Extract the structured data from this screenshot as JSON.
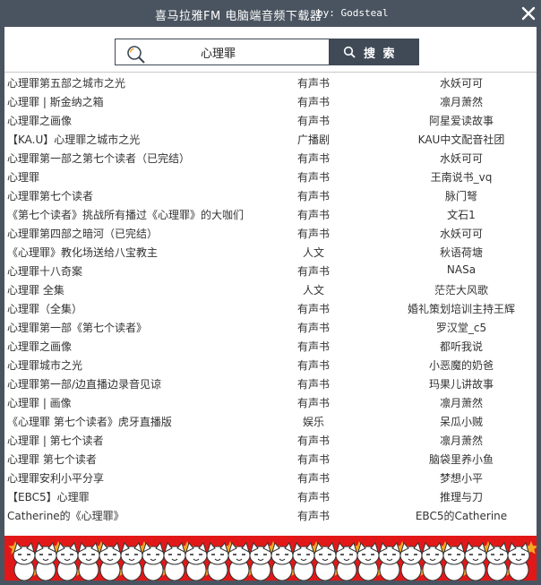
{
  "window": {
    "title": "喜马拉雅FM 电脑端音频下载器",
    "author": "by: Godsteal"
  },
  "search": {
    "value": "心理罪",
    "button_label": "搜 索"
  },
  "results": [
    {
      "title": "心理罪第五部之城市之光",
      "category": "有声书",
      "author": "水妖可可"
    },
    {
      "title": "心理罪 | 斯金纳之箱",
      "category": "有声书",
      "author": "凛月萧然"
    },
    {
      "title": "心理罪之画像",
      "category": "有声书",
      "author": "阿星爱读故事"
    },
    {
      "title": "【KA.U】心理罪之城市之光",
      "category": "广播剧",
      "author": "KAU中文配音社团"
    },
    {
      "title": "心理罪第一部之第七个读者（已完结）",
      "category": "有声书",
      "author": "水妖可可"
    },
    {
      "title": "心理罪",
      "category": "有声书",
      "author": "王南说书_vq"
    },
    {
      "title": "心理罪第七个读者",
      "category": "有声书",
      "author": "脉门弩"
    },
    {
      "title": "《第七个读者》挑战所有播过《心理罪》的大咖们",
      "category": "有声书",
      "author": "文石1"
    },
    {
      "title": "心理罪第四部之暗河（已完结）",
      "category": "有声书",
      "author": "水妖可可"
    },
    {
      "title": "《心理罪》教化场送给八宝教主",
      "category": "人文",
      "author": "秋语荷塘"
    },
    {
      "title": "心理罪十八奇案",
      "category": "有声书",
      "author": "NASa"
    },
    {
      "title": "心理罪 全集",
      "category": "人文",
      "author": "茫茫大风歌"
    },
    {
      "title": "心理罪（全集）",
      "category": "有声书",
      "author": "婚礼策划培训主持王辉"
    },
    {
      "title": "心理罪第一部《第七个读者》",
      "category": "有声书",
      "author": "罗汉堂_c5"
    },
    {
      "title": "心理罪之画像",
      "category": "有声书",
      "author": "都听我说"
    },
    {
      "title": "心理罪城市之光",
      "category": "有声书",
      "author": "小恶魔的奶爸"
    },
    {
      "title": "心理罪第一部/边直播边录音见谅",
      "category": "有声书",
      "author": "玛果儿讲故事"
    },
    {
      "title": "心理罪 | 画像",
      "category": "有声书",
      "author": "凛月萧然"
    },
    {
      "title": "《心理罪 第七个读者》虎牙直播版",
      "category": "娱乐",
      "author": "呆瓜小贼"
    },
    {
      "title": "心理罪 | 第七个读者",
      "category": "有声书",
      "author": "凛月萧然"
    },
    {
      "title": "心理罪 第七个读者",
      "category": "有声书",
      "author": "脑袋里养小鱼"
    },
    {
      "title": "心理罪安利小平分享",
      "category": "有声书",
      "author": "梦想小平"
    },
    {
      "title": "【EBC5】心理罪",
      "category": "有声书",
      "author": "推理与刀"
    },
    {
      "title": "Catherine的《心理罪》",
      "category": "有声书",
      "author": "EBC5的Catherine"
    }
  ],
  "colors": {
    "chrome": "#4a5460",
    "button": "#3f4a56",
    "footer": "#e21818"
  }
}
